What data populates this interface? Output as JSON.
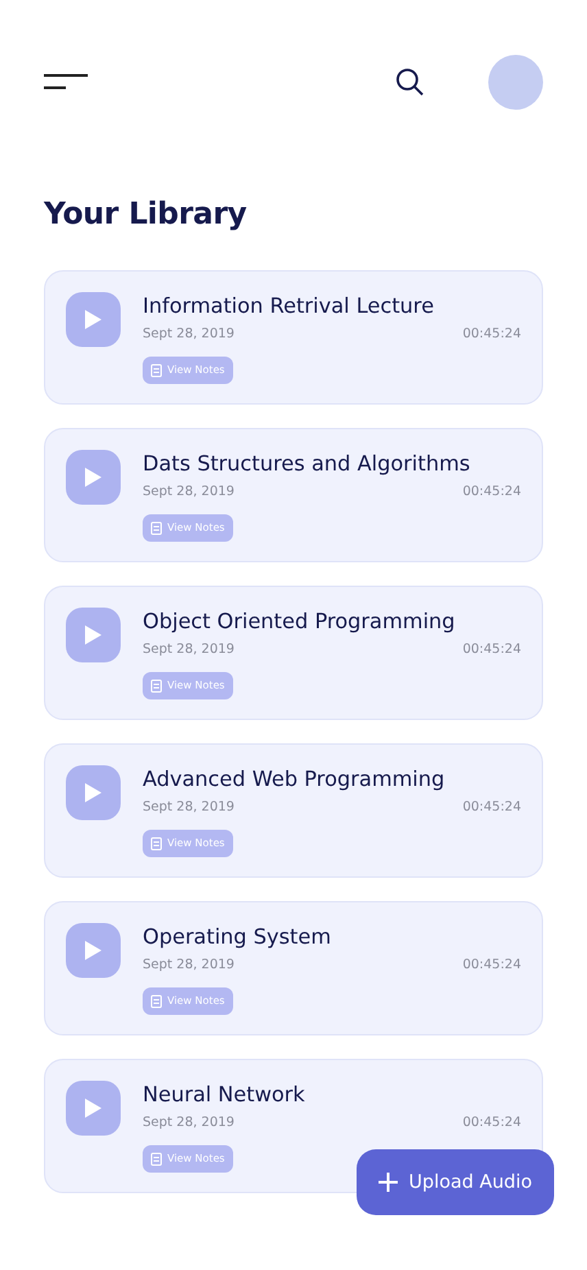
{
  "title": "Your Library",
  "recordings": [
    {
      "title": "Information Retrival Lecture",
      "date": "Sept 28, 2019",
      "duration": "00:45:24",
      "notes_label": "View Notes"
    },
    {
      "title": "Dats Structures and Algorithms",
      "date": "Sept 28, 2019",
      "duration": "00:45:24",
      "notes_label": "View Notes"
    },
    {
      "title": "Object Oriented Programming",
      "date": "Sept 28, 2019",
      "duration": "00:45:24",
      "notes_label": "View Notes"
    },
    {
      "title": "Advanced Web Programming",
      "date": "Sept 28, 2019",
      "duration": "00:45:24",
      "notes_label": "View Notes"
    },
    {
      "title": "Operating System",
      "date": "Sept 28, 2019",
      "duration": "00:45:24",
      "notes_label": "View Notes"
    },
    {
      "title": "Neural Network",
      "date": "Sept 28, 2019",
      "duration": "00:45:24",
      "notes_label": "View Notes"
    }
  ],
  "upload_button": "Upload Audio"
}
